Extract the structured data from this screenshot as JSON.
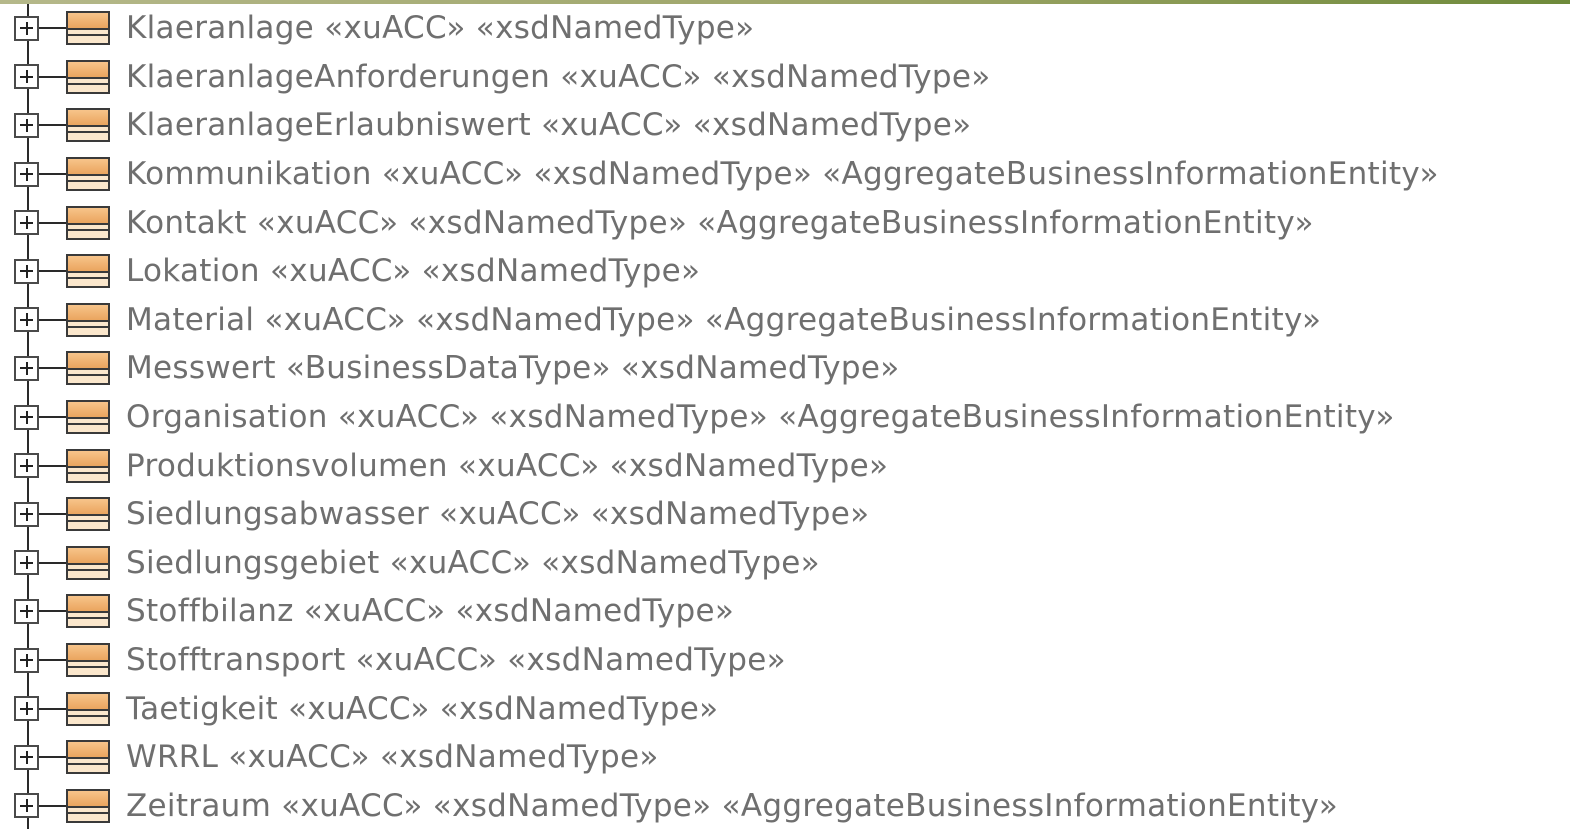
{
  "tree": {
    "items": [
      {
        "label": "Klaeranlage «xuACC» «xsdNamedType»"
      },
      {
        "label": "KlaeranlageAnforderungen «xuACC» «xsdNamedType»"
      },
      {
        "label": "KlaeranlageErlaubniswert «xuACC» «xsdNamedType»"
      },
      {
        "label": "Kommunikation «xuACC» «xsdNamedType» «AggregateBusinessInformationEntity»"
      },
      {
        "label": "Kontakt «xuACC» «xsdNamedType» «AggregateBusinessInformationEntity»"
      },
      {
        "label": "Lokation «xuACC» «xsdNamedType»"
      },
      {
        "label": "Material «xuACC» «xsdNamedType» «AggregateBusinessInformationEntity»"
      },
      {
        "label": "Messwert «BusinessDataType» «xsdNamedType»"
      },
      {
        "label": "Organisation «xuACC» «xsdNamedType» «AggregateBusinessInformationEntity»"
      },
      {
        "label": "Produktionsvolumen «xuACC» «xsdNamedType»"
      },
      {
        "label": "Siedlungsabwasser «xuACC» «xsdNamedType»"
      },
      {
        "label": "Siedlungsgebiet «xuACC» «xsdNamedType»"
      },
      {
        "label": "Stoffbilanz «xuACC» «xsdNamedType»"
      },
      {
        "label": "Stofftransport «xuACC» «xsdNamedType»"
      },
      {
        "label": "Taetigkeit «xuACC» «xsdNamedType»"
      },
      {
        "label": "WRRL «xuACC» «xsdNamedType»"
      },
      {
        "label": "Zeitraum «xuACC» «xsdNamedType» «AggregateBusinessInformationEntity»"
      }
    ]
  },
  "icons": {
    "expander": "expand-plus-icon",
    "node": "class-icon"
  },
  "colors": {
    "label_text": "#6f6f6f",
    "class_icon_fill": "#e9a25a",
    "class_icon_light": "#fbe7cc"
  }
}
